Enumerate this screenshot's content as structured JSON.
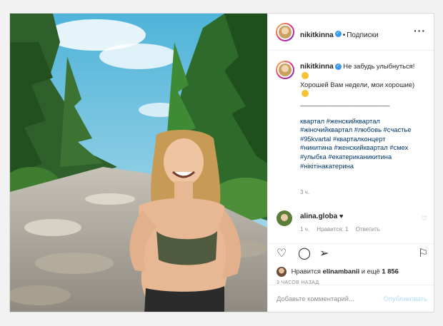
{
  "post": {
    "username": "nikitkinna",
    "follow_label": "Подписки",
    "more_label": "···",
    "caption_lines": [
      "Не забудь улыбнуться!",
      "Хорошей Вам недели, мои хорошие)",
      "________________________"
    ],
    "hashtags": [
      "квартал #женскийквартал",
      "#жiночийквартал #любовь #счастье",
      "#95kvartal #кварталконцерт",
      "#никитина #женскийквартал #смех",
      "#улыбка #екатериканикитина",
      "#нікітінакатерина"
    ],
    "time": "3 ч.",
    "comment": {
      "username": "alina.globa",
      "text": "♥",
      "time": "1 ч.",
      "likes": "Нравится: 1",
      "reply": "Ответить"
    },
    "likes_prefix": "Нравится",
    "likes_user": "elinambanii",
    "likes_suffix": "и ещё",
    "likes_count": "1 856",
    "ago": "3 ЧАСОВ НАЗАД",
    "add_comment_placeholder": "Добавьте комментарий...",
    "publish_label": "Опубликовать"
  },
  "icons": {
    "heart": "heart-icon",
    "comment": "comment-icon",
    "share": "share-icon",
    "save": "bookmark-icon"
  },
  "colors": {
    "link": "#00376b",
    "verified": "#3897f0",
    "muted": "#8e8e8e",
    "publish": "#b2dffc"
  }
}
